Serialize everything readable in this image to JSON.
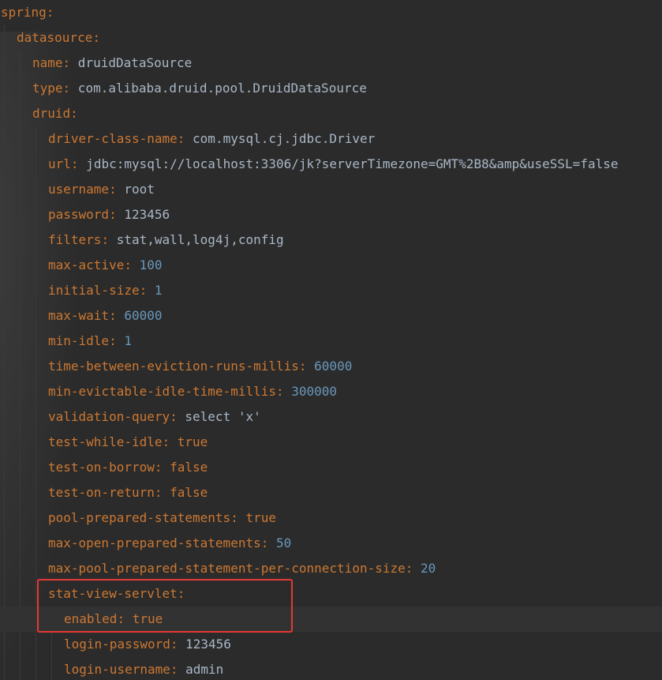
{
  "editor": {
    "lines": [
      {
        "indent": 0,
        "key": "spring",
        "value": "",
        "vtype": "none"
      },
      {
        "indent": 1,
        "key": "datasource",
        "value": "",
        "vtype": "none"
      },
      {
        "indent": 2,
        "key": "name",
        "value": "druidDataSource",
        "vtype": "str"
      },
      {
        "indent": 2,
        "key": "type",
        "value": "com.alibaba.druid.pool.DruidDataSource",
        "vtype": "str"
      },
      {
        "indent": 2,
        "key": "druid",
        "value": "",
        "vtype": "none"
      },
      {
        "indent": 3,
        "key": "driver-class-name",
        "value": "com.mysql.cj.jdbc.Driver",
        "vtype": "str"
      },
      {
        "indent": 3,
        "key": "url",
        "value": "jdbc:mysql://localhost:3306/jk?serverTimezone=GMT%2B8&amp&useSSL=false",
        "vtype": "str"
      },
      {
        "indent": 3,
        "key": "username",
        "value": "root",
        "vtype": "str"
      },
      {
        "indent": 3,
        "key": "password",
        "value": "123456",
        "vtype": "str"
      },
      {
        "indent": 3,
        "key": "filters",
        "value": "stat,wall,log4j,config",
        "vtype": "str"
      },
      {
        "indent": 3,
        "key": "max-active",
        "value": "100",
        "vtype": "num"
      },
      {
        "indent": 3,
        "key": "initial-size",
        "value": "1",
        "vtype": "num"
      },
      {
        "indent": 3,
        "key": "max-wait",
        "value": "60000",
        "vtype": "num"
      },
      {
        "indent": 3,
        "key": "min-idle",
        "value": "1",
        "vtype": "num"
      },
      {
        "indent": 3,
        "key": "time-between-eviction-runs-millis",
        "value": "60000",
        "vtype": "num"
      },
      {
        "indent": 3,
        "key": "min-evictable-idle-time-millis",
        "value": "300000",
        "vtype": "num"
      },
      {
        "indent": 3,
        "key": "validation-query",
        "value": "select 'x'",
        "vtype": "str"
      },
      {
        "indent": 3,
        "key": "test-while-idle",
        "value": "true",
        "vtype": "bool"
      },
      {
        "indent": 3,
        "key": "test-on-borrow",
        "value": "false",
        "vtype": "bool"
      },
      {
        "indent": 3,
        "key": "test-on-return",
        "value": "false",
        "vtype": "bool"
      },
      {
        "indent": 3,
        "key": "pool-prepared-statements",
        "value": "true",
        "vtype": "bool"
      },
      {
        "indent": 3,
        "key": "max-open-prepared-statements",
        "value": "50",
        "vtype": "num"
      },
      {
        "indent": 3,
        "key": "max-pool-prepared-statement-per-connection-size",
        "value": "20",
        "vtype": "num"
      },
      {
        "indent": 3,
        "key": "stat-view-servlet",
        "value": "",
        "vtype": "none"
      },
      {
        "indent": 4,
        "key": "enabled",
        "value": "true",
        "vtype": "bool",
        "current": true
      },
      {
        "indent": 4,
        "key": "login-password",
        "value": "123456",
        "vtype": "str"
      },
      {
        "indent": 4,
        "key": "login-username",
        "value": "admin",
        "vtype": "str"
      }
    ]
  },
  "colors": {
    "background": "#2b2b2b",
    "key": "#cc7832",
    "string": "#a9b7c6",
    "number": "#6897bb",
    "boolean": "#cc7832",
    "highlight_box": "#e53935"
  }
}
